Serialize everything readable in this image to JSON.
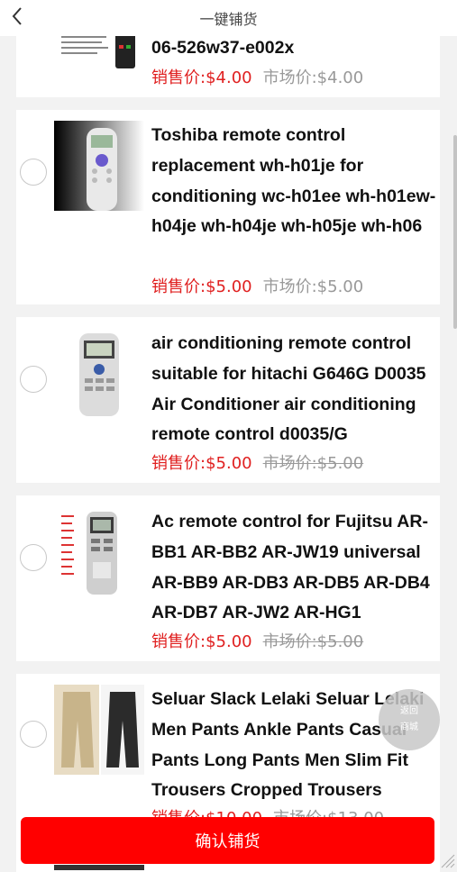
{
  "header": {
    "title": "一键铺货"
  },
  "products": [
    {
      "title": "06-526w37-e002x",
      "sale_price": "销售价:$4.00",
      "market_price": "市场价:$4.00",
      "market_strike": false
    },
    {
      "title": "Toshiba remote control replacement wh-h01je for conditioning wc-h01ee wh-h01ew-h04je wh-h04je wh-h05je wh-h06",
      "sale_price": "销售价:$5.00",
      "market_price": "市场价:$5.00",
      "market_strike": false
    },
    {
      "title": "air conditioning remote control suitable for hitachi G646G D0035 Air Conditioner air conditioning remote control d0035/G",
      "sale_price": "销售价:$5.00",
      "market_price": "市场价:$5.00",
      "market_strike": true
    },
    {
      "title": "Ac remote control for Fujitsu AR-BB1 AR-BB2 AR-JW19 universal AR-BB9 AR-DB3 AR-DB5 AR-DB4 AR-DB7 AR-JW2 AR-HG1",
      "sale_price": "销售价:$5.00",
      "market_price": "市场价:$5.00",
      "market_strike": true
    },
    {
      "title": "Seluar Slack Lelaki Seluar Lelaki Men Pants Ankle Pants Casual Pants Long Pants Men Slim Fit Trousers Cropped Trousers",
      "sale_price": "销售价:$10.00",
      "market_price": "市场价:$13.00",
      "market_strike": true
    }
  ],
  "float_button": {
    "line1": "返回",
    "line2": "商城"
  },
  "confirm_button": {
    "label": "确认铺货"
  },
  "colors": {
    "accent": "#ff0000",
    "sale": "#e02020",
    "market": "#999999",
    "background": "#f2f2f2"
  }
}
